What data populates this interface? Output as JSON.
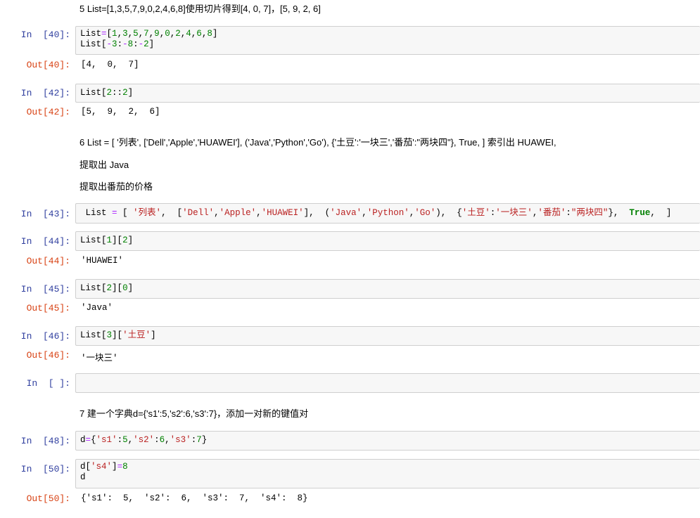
{
  "markdown": {
    "q5": "5 List=[1,3,5,7,9,0,2,4,6,8]使用切片得到[4, 0, 7]，[5, 9, 2, 6]",
    "q6_line1": "6 List = [ '列表', ['Dell','Apple','HUAWEI'], ('Java','Python','Go'), {'土豆':'一块三','番茄':\"两块四\"}, True, ] 索引出 HUAWEI,",
    "q6_line2": "提取出 Java",
    "q6_line3": "提取出番茄的价格",
    "q7": "7 建一个字典d={'s1':5,'s2':6,'s3':7}，添加一对新的键值对"
  },
  "cells": {
    "c40": {
      "in_prompt": "In  [40]:",
      "out_prompt": "Out[40]:",
      "output": "[4,  0,  7]"
    },
    "c42": {
      "in_prompt": "In  [42]:",
      "out_prompt": "Out[42]:",
      "output": "[5,  9,  2,  6]"
    },
    "c43": {
      "in_prompt": "In  [43]:"
    },
    "c44": {
      "in_prompt": "In  [44]:",
      "out_prompt": "Out[44]:",
      "output": "'HUAWEI'"
    },
    "c45": {
      "in_prompt": "In  [45]:",
      "out_prompt": "Out[45]:",
      "output": "'Java'"
    },
    "c46": {
      "in_prompt": "In  [46]:",
      "out_prompt": "Out[46]:",
      "output": "'一块三'"
    },
    "cempty": {
      "in_prompt": "In  [ ]:"
    },
    "c48": {
      "in_prompt": "In  [48]:"
    },
    "c50": {
      "in_prompt": "In  [50]:",
      "out_prompt": "Out[50]:",
      "output": "{'s1':  5,  's2':  6,  's3':  7,  's4':  8}"
    }
  },
  "code": {
    "c40_l1": [
      "List",
      "=",
      "[",
      "1",
      ",",
      "3",
      ",",
      "5",
      ",",
      "7",
      ",",
      "9",
      ",",
      "0",
      ",",
      "2",
      ",",
      "4",
      ",",
      "6",
      ",",
      "8",
      "]"
    ],
    "c40_l2": [
      "List",
      "[",
      "-",
      "3",
      ":",
      "-",
      "8",
      ":",
      "-",
      "2",
      "]"
    ],
    "c42": [
      "List",
      "[",
      "2",
      "::",
      "2",
      "]"
    ],
    "c43": [
      " List ",
      "=",
      " [ ",
      "'列表'",
      ",  [",
      "'Dell'",
      ",",
      "'Apple'",
      ",",
      "'HUAWEI'",
      "],  (",
      "'Java'",
      ",",
      "'Python'",
      ",",
      "'Go'",
      "),  {",
      "'土豆'",
      ":",
      "'一块三'",
      ",",
      "'番茄'",
      ":",
      "\"两块四\"",
      "},  ",
      "True",
      ",  ]"
    ],
    "c44": [
      "List",
      "[",
      "1",
      "][",
      "2",
      "]"
    ],
    "c45": [
      "List",
      "[",
      "2",
      "][",
      "0",
      "]"
    ],
    "c46": [
      "List",
      "[",
      "3",
      "][",
      "'土豆'",
      "]"
    ],
    "c48": [
      "d",
      "=",
      "{",
      "'s1'",
      ":",
      "5",
      ",",
      "'s2'",
      ":",
      "6",
      ",",
      "'s3'",
      ":",
      "7",
      "}"
    ],
    "c50_l1": [
      "d",
      "[",
      "'s4'",
      "]",
      "=",
      "8"
    ],
    "c50_l2": [
      "d"
    ]
  },
  "syntax_colors": {
    "keyword": "#008000",
    "number": "#008000",
    "operator": "#aa22ff",
    "string": "#ba2121",
    "in_prompt": "#303f9f",
    "out_prompt": "#d84315"
  }
}
